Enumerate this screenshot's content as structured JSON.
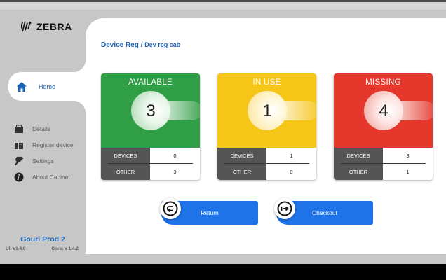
{
  "app": {
    "logo_text": "ZEBRA"
  },
  "nav": {
    "home": {
      "label": "Home",
      "icon": "home-icon"
    },
    "items": [
      {
        "label": "Details",
        "icon": "details-icon"
      },
      {
        "label": "Register device",
        "icon": "register-device-icon"
      },
      {
        "label": "Settings",
        "icon": "settings-icon"
      },
      {
        "label": "About Cabinet",
        "icon": "info-icon"
      }
    ]
  },
  "profile": {
    "name": "Gouri Prod 2",
    "ui_version": "UI: v1.4.0",
    "core_version": "Core: v 1.4.2"
  },
  "breadcrumb": {
    "root": "Device Reg",
    "separator": "/",
    "current": "Dev reg cab"
  },
  "cards": [
    {
      "title": "AVAILABLE",
      "count": "3",
      "color": "#2f9e44",
      "devices_label": "DEVICES",
      "devices": "0",
      "other_label": "OTHER",
      "other": "3"
    },
    {
      "title": "IN USE",
      "count": "1",
      "color": "#f5c518",
      "devices_label": "DEVICES",
      "devices": "1",
      "other_label": "OTHER",
      "other": "0"
    },
    {
      "title": "MISSING",
      "count": "4",
      "color": "#e5372b",
      "devices_label": "DEVICES",
      "devices": "3",
      "other_label": "OTHER",
      "other": "1"
    }
  ],
  "actions": {
    "return": {
      "label": "Return",
      "icon": "return-icon"
    },
    "checkout": {
      "label": "Checkout",
      "icon": "checkout-icon"
    }
  },
  "colors": {
    "accent": "#1b62b4",
    "button": "#1e73e8"
  }
}
